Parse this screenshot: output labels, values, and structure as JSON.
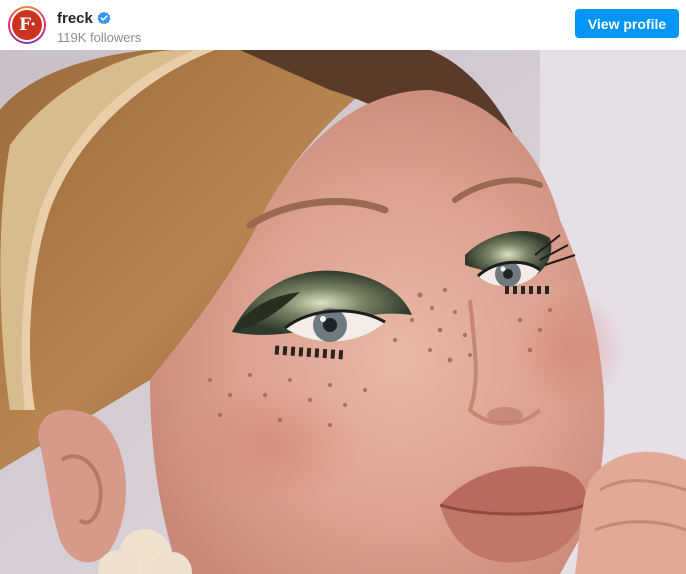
{
  "account": {
    "username": "freck",
    "followers": "119K followers",
    "avatar_letter": "F·",
    "verified": true,
    "verified_icon": "verified-badge-icon",
    "verified_color": "#3897f0",
    "avatar_color": "#c8341f"
  },
  "header": {
    "view_profile_label": "View profile",
    "button_color": "#0095f6"
  },
  "post": {
    "media_type": "photo"
  }
}
